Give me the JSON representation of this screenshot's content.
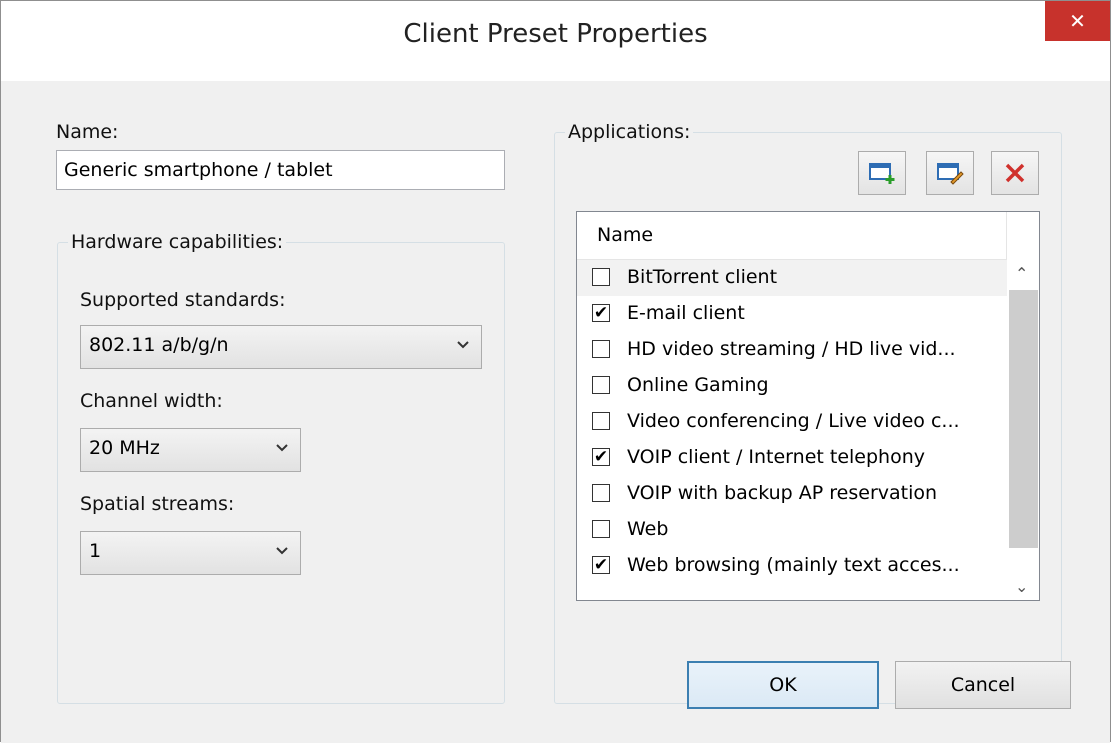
{
  "window": {
    "title": "Client Preset Properties",
    "close_glyph": "✕"
  },
  "name_section": {
    "label": "Name:",
    "value": "Generic smartphone / tablet"
  },
  "hardware": {
    "caption": "Hardware capabilities:",
    "standards_label": "Supported standards:",
    "standards_value": "802.11 a/b/g/n",
    "channel_label": "Channel width:",
    "channel_value": "20 MHz",
    "streams_label": "Spatial streams:",
    "streams_value": "1"
  },
  "applications": {
    "caption": "Applications:",
    "toolbar": [
      "add-application-icon",
      "edit-application-icon",
      "delete-application-icon"
    ],
    "column_header": "Name",
    "items": [
      {
        "label": "BitTorrent client",
        "checked": false
      },
      {
        "label": "E-mail client",
        "checked": true
      },
      {
        "label": "HD video streaming / HD live vid...",
        "checked": false
      },
      {
        "label": "Online Gaming",
        "checked": false
      },
      {
        "label": "Video conferencing / Live video c...",
        "checked": false
      },
      {
        "label": "VOIP client / Internet telephony",
        "checked": true
      },
      {
        "label": "VOIP with backup AP reservation",
        "checked": false
      },
      {
        "label": "Web",
        "checked": false
      },
      {
        "label": "Web browsing (mainly text acces...",
        "checked": true
      }
    ]
  },
  "buttons": {
    "ok": "OK",
    "cancel": "Cancel"
  },
  "colors": {
    "close_bg": "#c7322c",
    "default_button_border": "#3c7fb1",
    "delete_icon": "#d0312d"
  }
}
